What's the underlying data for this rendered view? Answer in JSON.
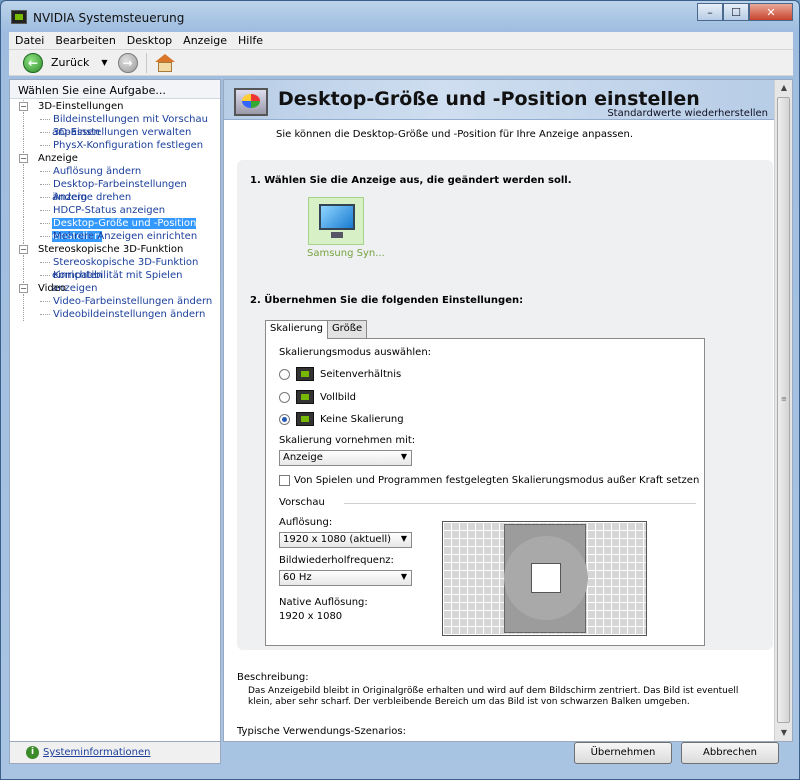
{
  "window": {
    "title": "NVIDIA Systemsteuerung",
    "min": "–",
    "max": "☐",
    "close": "✕"
  },
  "menu": [
    "Datei",
    "Bearbeiten",
    "Desktop",
    "Anzeige",
    "Hilfe"
  ],
  "toolbar": {
    "back_label": "Zurück",
    "back_glyph": "←",
    "fwd_glyph": "→",
    "dropdown_glyph": "▼"
  },
  "sidebar": {
    "header": "Wählen Sie eine Aufgabe...",
    "categories": [
      {
        "label": "3D-Einstellungen",
        "items": [
          "Bildeinstellungen mit Vorschau anpassen",
          "3D-Einstellungen verwalten",
          "PhysX-Konfiguration festlegen"
        ]
      },
      {
        "label": "Anzeige",
        "items": [
          "Auflösung ändern",
          "Desktop-Farbeinstellungen ändern",
          "Anzeige drehen",
          "HDCP-Status anzeigen",
          "Desktop-Größe und -Position einstellen",
          "Mehrere Anzeigen einrichten"
        ]
      },
      {
        "label": "Stereoskopische 3D-Funktion",
        "items": [
          "Stereoskopische 3D-Funktion einrichten",
          "Kompatibilität mit Spielen anzeigen"
        ]
      },
      {
        "label": "Video",
        "items": [
          "Video-Farbeinstellungen ändern",
          "Videobildeinstellungen ändern"
        ]
      }
    ],
    "selected_item": "Desktop-Größe und -Position einstellen",
    "expander": "−",
    "sysinfo_label": "Systeminformationen",
    "sysinfo_icon": "i"
  },
  "main": {
    "title": "Desktop-Größe und -Position einstellen",
    "reset_link": "Standardwerte wiederherstellen",
    "intro": "Sie können die Desktop-Größe und -Position für Ihre Anzeige anpassen.",
    "step1": "1. Wählen Sie die Anzeige aus, die geändert werden soll.",
    "display_label": "Samsung Syn...",
    "step2": "2. Übernehmen Sie die folgenden Einstellungen:",
    "tabs": [
      "Skalierung",
      "Größe"
    ],
    "scaling_mode_label": "Skalierungsmodus auswählen:",
    "modes": [
      "Seitenverhältnis",
      "Vollbild",
      "Keine Skalierung"
    ],
    "selected_mode": "Keine Skalierung",
    "perform_with_label": "Skalierung vornehmen mit:",
    "perform_with_value": "Anzeige",
    "override_label": "Von Spielen und Programmen festgelegten Skalierungsmodus außer Kraft setzen",
    "override_checked": false,
    "preview_label": "Vorschau",
    "resolution_label": "Auflösung:",
    "resolution_value": "1920 x 1080 (aktuell)",
    "refresh_label": "Bildwiederholfrequenz:",
    "refresh_value": "60 Hz",
    "native_label": "Native Auflösung:",
    "native_value": "1920 x 1080",
    "description_head": "Beschreibung:",
    "description_text": "Das Anzeigebild bleibt in Originalgröße erhalten und wird auf dem Bildschirm zentriert. Das Bild ist eventuell klein, aber sehr scharf. Der verbleibende Bereich um das Bild ist von schwarzen Balken umgeben.",
    "usage_head": "Typische Verwendungs-Szenarios:"
  },
  "buttons": {
    "apply": "Übernehmen",
    "cancel": "Abbrechen"
  },
  "icons": {
    "select_arrow": "▼",
    "scroll_up": "▲",
    "scroll_down": "▼",
    "scroll_grip": "≡"
  },
  "colors": {
    "nvidia_green": "#76b900",
    "link_blue": "#1b3f9b",
    "selection": "#3399ff"
  }
}
